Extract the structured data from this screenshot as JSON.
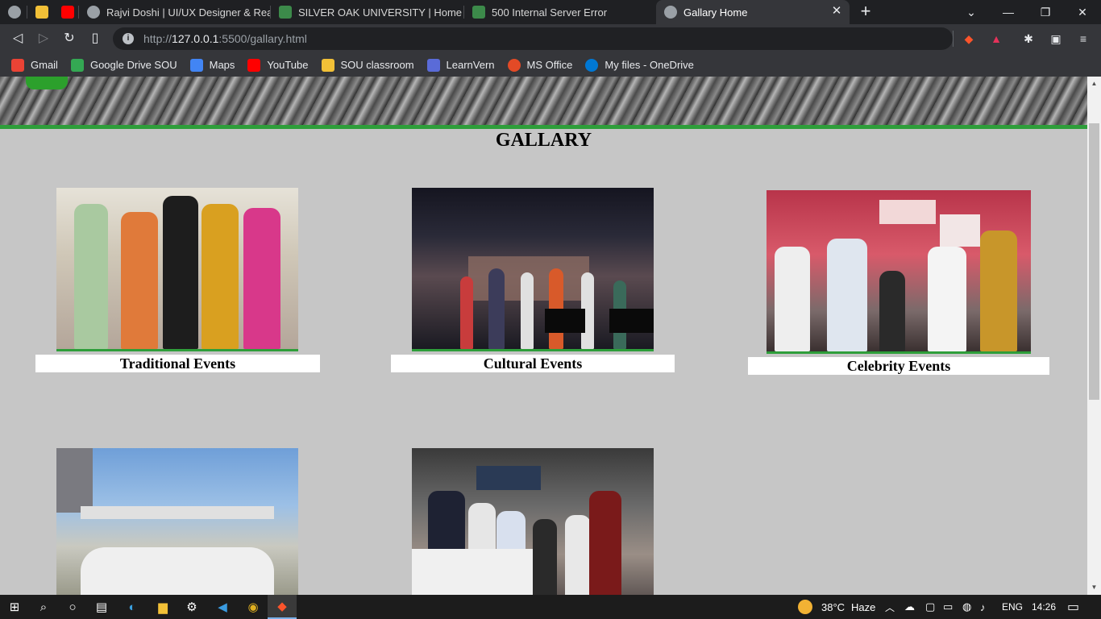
{
  "browser": {
    "tabs": [
      {
        "title": "",
        "color": "#9aa0a6"
      },
      {
        "title": "",
        "color": "#f2c037"
      },
      {
        "title": "",
        "color": "#ff0000"
      },
      {
        "title": "Rajvi Doshi | UI/UX Designer & React D",
        "color": "#9aa0a6"
      },
      {
        "title": "SILVER OAK UNIVERSITY | Home",
        "color": "#3c8a4a"
      },
      {
        "title": "500 Internal Server Error",
        "color": "#3c8a4a"
      },
      {
        "title": "Gallary Home",
        "color": "#9aa0a6",
        "active": true
      }
    ],
    "new_tab": "+",
    "url_host": "127.0.0.1",
    "url_prefix": "http://",
    "url_rest": ":5500/gallary.html",
    "bookmarks": [
      {
        "label": "Gmail",
        "color": "#ea4335"
      },
      {
        "label": "Google Drive SOU",
        "color": "#34a853"
      },
      {
        "label": "Maps",
        "color": "#4285f4"
      },
      {
        "label": "YouTube",
        "color": "#ff0000"
      },
      {
        "label": "SOU classroom",
        "color": "#f2c037"
      },
      {
        "label": "LearnVern",
        "color": "#5a6bd8"
      },
      {
        "label": "MS Office",
        "color": "#e34a26"
      },
      {
        "label": "My files - OneDrive",
        "color": "#0078d4"
      }
    ]
  },
  "page": {
    "title": "GALLARY",
    "cards": [
      {
        "label": "Traditional Events",
        "photo": "traditional"
      },
      {
        "label": "Cultural Events",
        "photo": "cultural"
      },
      {
        "label": "Celebrity Events",
        "photo": "celebrity"
      },
      {
        "label": "",
        "photo": "cricket"
      },
      {
        "label": "",
        "photo": "tech-expo"
      }
    ]
  },
  "taskbar": {
    "weather_temp": "38°C",
    "weather_desc": "Haze",
    "language": "ENG",
    "time": "14:26"
  }
}
